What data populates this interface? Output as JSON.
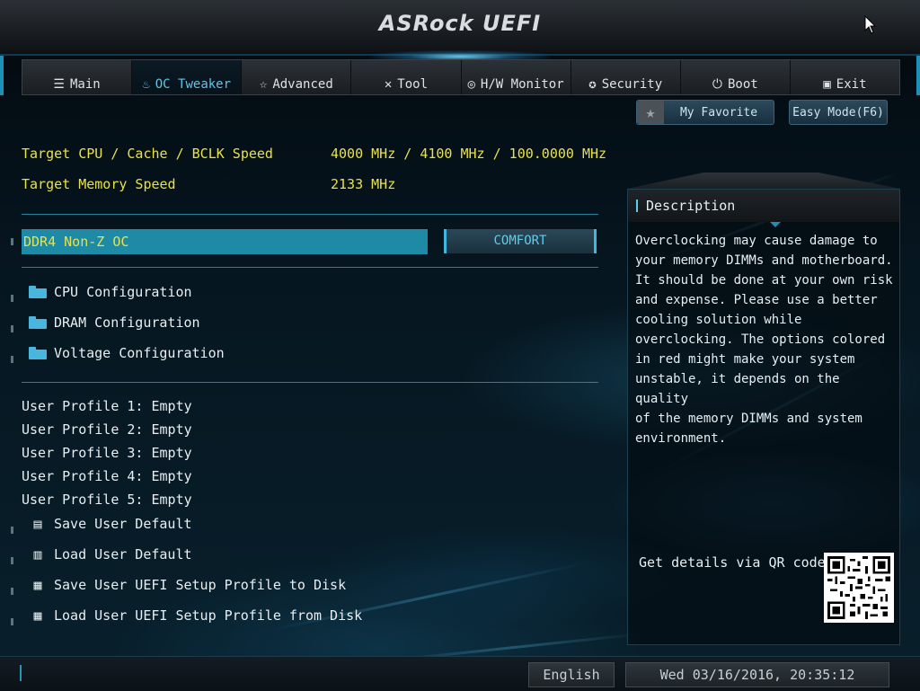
{
  "header": {
    "logo": "ASRock UEFI"
  },
  "nav": {
    "tabs": [
      {
        "label": "Main",
        "icon": "list-icon",
        "glyph": "☰",
        "active": false
      },
      {
        "label": "OC Tweaker",
        "icon": "flame-icon",
        "glyph": "♨",
        "active": true
      },
      {
        "label": "Advanced",
        "icon": "star-outline-icon",
        "glyph": "☆",
        "active": false
      },
      {
        "label": "Tool",
        "icon": "tools-icon",
        "glyph": "✕",
        "active": false
      },
      {
        "label": "H/W Monitor",
        "icon": "gauge-icon",
        "glyph": "◎",
        "active": false
      },
      {
        "label": "Security",
        "icon": "shield-icon",
        "glyph": "✪",
        "active": false
      },
      {
        "label": "Boot",
        "icon": "power-icon",
        "glyph": "⏻",
        "active": false
      },
      {
        "label": "Exit",
        "icon": "exit-door-icon",
        "glyph": "▣",
        "active": false
      }
    ]
  },
  "favorite": {
    "label": "My Favorite"
  },
  "easy_mode": {
    "label": "Easy Mode(F6)"
  },
  "targets": {
    "cpu_label": "Target CPU / Cache / BCLK Speed",
    "cpu_value": "4000 MHz / 4100 MHz / 100.0000 MHz",
    "mem_label": "Target Memory Speed",
    "mem_value": "2133 MHz"
  },
  "selected_option": {
    "label": "DDR4 Non-Z OC",
    "value": "COMFORT"
  },
  "submenus": [
    "CPU Configuration",
    "DRAM Configuration",
    "Voltage Configuration"
  ],
  "profiles": [
    "User Profile 1: Empty",
    "User Profile 2: Empty",
    "User Profile 3: Empty",
    "User Profile 4: Empty",
    "User Profile 5: Empty"
  ],
  "actions": [
    {
      "label": "Save User Default",
      "icon": "floppy-disk-icon",
      "glyph": "💾"
    },
    {
      "label": "Load User Default",
      "icon": "book-icon",
      "glyph": "📖"
    },
    {
      "label": "Save User UEFI Setup Profile to Disk",
      "icon": "disk-save-icon",
      "glyph": "🖫"
    },
    {
      "label": "Load User UEFI Setup Profile from Disk",
      "icon": "disk-load-icon",
      "glyph": "🖫"
    }
  ],
  "description": {
    "title": "Description",
    "text": "Overclocking may cause damage to\nyour memory DIMMs and motherboard.\nIt should be done at your own risk\nand expense. Please use a better\ncooling solution while\noverclocking. The options colored\nin red might make your system\nunstable, it depends on the quality\nof the memory DIMMs and system\nenvironment.",
    "qr_label": "Get details via QR code"
  },
  "footer": {
    "language": "English",
    "datetime": "Wed 03/16/2016, 20:35:12"
  },
  "colors": {
    "accent": "#1f8aa6",
    "highlight_text": "#e8e24a",
    "active_tab_text": "#5fc4e8"
  }
}
